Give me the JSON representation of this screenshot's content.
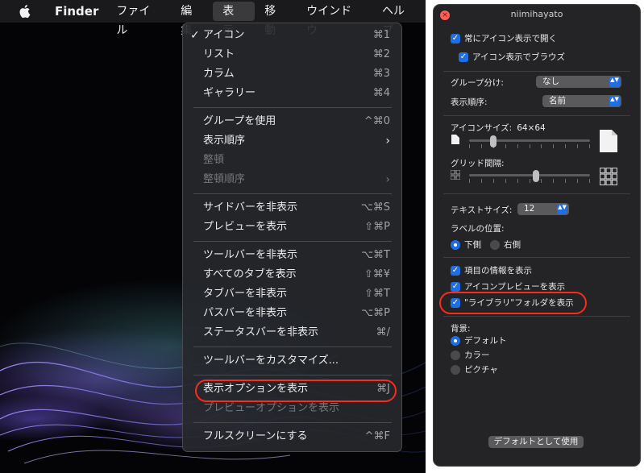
{
  "menubar": {
    "items": [
      "Finder",
      "ファイル",
      "編集",
      "表示",
      "移動",
      "ウインドウ",
      "ヘルプ"
    ],
    "active": "表示"
  },
  "view_menu": {
    "items": [
      {
        "label": "アイコン",
        "shortcut": "⌘1",
        "checked": true
      },
      {
        "label": "リスト",
        "shortcut": "⌘2"
      },
      {
        "label": "カラム",
        "shortcut": "⌘3"
      },
      {
        "label": "ギャラリー",
        "shortcut": "⌘4"
      },
      {
        "label": "グループを使用",
        "shortcut": "^⌘0"
      },
      {
        "label": "表示順序",
        "submenu": true
      },
      {
        "label": "整頓",
        "disabled": true
      },
      {
        "label": "整頓順序",
        "submenu": true,
        "disabled": true
      },
      {
        "label": "サイドバーを非表示",
        "shortcut": "⌥⌘S"
      },
      {
        "label": "プレビューを表示",
        "shortcut": "⇧⌘P"
      },
      {
        "label": "ツールバーを非表示",
        "shortcut": "⌥⌘T"
      },
      {
        "label": "すべてのタブを表示",
        "shortcut": "⇧⌘¥"
      },
      {
        "label": "タブバーを非表示",
        "shortcut": "⇧⌘T"
      },
      {
        "label": "パスバーを非表示",
        "shortcut": "⌥⌘P"
      },
      {
        "label": "ステータスバーを非表示",
        "shortcut": "⌘/"
      },
      {
        "label": "ツールバーをカスタマイズ..."
      },
      {
        "label": "表示オプションを表示",
        "shortcut": "⌘J",
        "highlighted": true
      },
      {
        "label": "プレビューオプションを表示",
        "disabled": true
      },
      {
        "label": "フルスクリーンにする",
        "shortcut": "^⌘F"
      }
    ],
    "checkmark": "✓",
    "submenu_arrow": "›"
  },
  "options_panel": {
    "title": "niimihayato",
    "always_open_icon": {
      "label": "常にアイコン表示で開く",
      "checked": true
    },
    "browse_icon": {
      "label": "アイコン表示でブラウズ",
      "checked": true
    },
    "group_by": {
      "label": "グループ分け:",
      "value": "なし"
    },
    "sort_by": {
      "label": "表示順序:",
      "value": "名前"
    },
    "icon_size": {
      "label": "アイコンサイズ:",
      "value": "64×64",
      "level": 0.2
    },
    "grid_spacing": {
      "label": "グリッド間隔:",
      "level": 0.55
    },
    "text_size": {
      "label": "テキストサイズ:",
      "value": "12"
    },
    "label_position": {
      "label": "ラベルの位置:",
      "options": [
        "下側",
        "右側"
      ],
      "selected": "下側"
    },
    "show_item_info": {
      "label": "項目の情報を表示",
      "checked": true
    },
    "show_icon_preview": {
      "label": "アイコンプレビューを表示",
      "checked": true
    },
    "show_library_folder": {
      "label": "\"ライブラリ\"フォルダを表示",
      "checked": true,
      "highlighted": true
    },
    "background": {
      "label": "背景:",
      "options": [
        "デフォルト",
        "カラー",
        "ピクチャ"
      ],
      "selected": "デフォルト"
    },
    "use_as_defaults": "デフォルトとして使用",
    "close_glyph": "×",
    "checkbox_glyph": "✓",
    "stepper_glyph": "▲▼"
  },
  "colors": {
    "accent": "#1e6fe3",
    "highlight_ring": "#ff2a1a"
  }
}
